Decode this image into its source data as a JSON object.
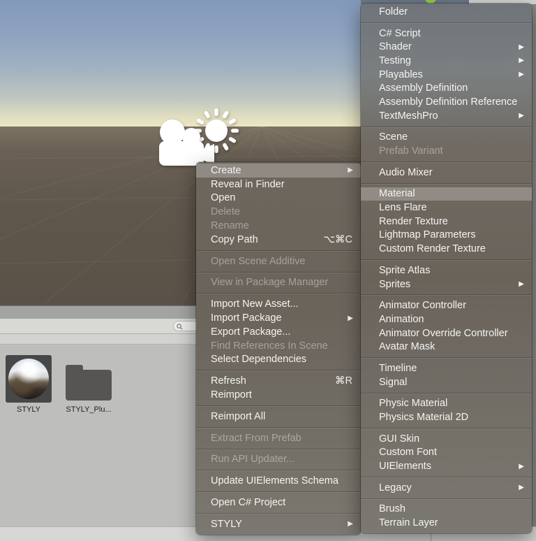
{
  "icons": {
    "submenu_arrow": "▶",
    "search": "magnifier",
    "collab_arrow": "green-down-arrow"
  },
  "colors": {
    "menu_text": "#f5f4f2",
    "menu_highlight": "rgba(255,255,255,0.24)",
    "collab_arrow_green": "#90c94e",
    "project_bg": "#bebebd",
    "selected_tile_bg": "#474747"
  },
  "scene": {
    "gizmos": [
      {
        "name": "camera"
      },
      {
        "name": "directional-light-sun"
      }
    ]
  },
  "project_panel": {
    "search": {
      "value": "",
      "placeholder": ""
    },
    "assets": [
      {
        "label": "STYLY",
        "type": "skybox-thumbnail",
        "selected": true
      },
      {
        "label": "STYLY_Plu...",
        "type": "folder",
        "selected": false
      }
    ]
  },
  "menus": {
    "left": {
      "name": "project-context-menu",
      "groups": [
        {
          "items": [
            {
              "label": "Create",
              "submenu": true,
              "highlighted": true
            },
            {
              "label": "Reveal in Finder"
            },
            {
              "label": "Open"
            },
            {
              "label": "Delete",
              "disabled": true
            },
            {
              "label": "Rename",
              "disabled": true
            },
            {
              "label": "Copy Path",
              "shortcut": "⌥⌘C"
            }
          ]
        },
        {
          "items": [
            {
              "label": "Open Scene Additive",
              "disabled": true
            }
          ]
        },
        {
          "items": [
            {
              "label": "View in Package Manager",
              "disabled": true
            }
          ]
        },
        {
          "items": [
            {
              "label": "Import New Asset..."
            },
            {
              "label": "Import Package",
              "submenu": true
            },
            {
              "label": "Export Package..."
            },
            {
              "label": "Find References In Scene",
              "disabled": true
            },
            {
              "label": "Select Dependencies"
            }
          ]
        },
        {
          "items": [
            {
              "label": "Refresh",
              "shortcut": "⌘R"
            },
            {
              "label": "Reimport"
            }
          ]
        },
        {
          "items": [
            {
              "label": "Reimport All"
            }
          ]
        },
        {
          "items": [
            {
              "label": "Extract From Prefab",
              "disabled": true
            }
          ]
        },
        {
          "items": [
            {
              "label": "Run API Updater...",
              "disabled": true
            }
          ]
        },
        {
          "items": [
            {
              "label": "Update UIElements Schema"
            }
          ]
        },
        {
          "items": [
            {
              "label": "Open C# Project"
            }
          ]
        },
        {
          "items": [
            {
              "label": "STYLY",
              "submenu": true
            }
          ]
        }
      ]
    },
    "create": {
      "name": "create-submenu",
      "groups": [
        {
          "items": [
            {
              "label": "Folder"
            }
          ]
        },
        {
          "items": [
            {
              "label": "C# Script"
            },
            {
              "label": "Shader",
              "submenu": true
            },
            {
              "label": "Testing",
              "submenu": true
            },
            {
              "label": "Playables",
              "submenu": true
            },
            {
              "label": "Assembly Definition"
            },
            {
              "label": "Assembly Definition Reference"
            },
            {
              "label": "TextMeshPro",
              "submenu": true
            }
          ]
        },
        {
          "items": [
            {
              "label": "Scene"
            },
            {
              "label": "Prefab Variant",
              "disabled": true
            }
          ]
        },
        {
          "items": [
            {
              "label": "Audio Mixer"
            }
          ]
        },
        {
          "items": [
            {
              "label": "Material",
              "highlighted": true
            },
            {
              "label": "Lens Flare"
            },
            {
              "label": "Render Texture"
            },
            {
              "label": "Lightmap Parameters"
            },
            {
              "label": "Custom Render Texture"
            }
          ]
        },
        {
          "items": [
            {
              "label": "Sprite Atlas"
            },
            {
              "label": "Sprites",
              "submenu": true
            }
          ]
        },
        {
          "items": [
            {
              "label": "Animator Controller"
            },
            {
              "label": "Animation"
            },
            {
              "label": "Animator Override Controller"
            },
            {
              "label": "Avatar Mask"
            }
          ]
        },
        {
          "items": [
            {
              "label": "Timeline"
            },
            {
              "label": "Signal"
            }
          ]
        },
        {
          "items": [
            {
              "label": "Physic Material"
            },
            {
              "label": "Physics Material 2D"
            }
          ]
        },
        {
          "items": [
            {
              "label": "GUI Skin"
            },
            {
              "label": "Custom Font"
            },
            {
              "label": "UIElements",
              "submenu": true
            }
          ]
        },
        {
          "items": [
            {
              "label": "Legacy",
              "submenu": true
            }
          ]
        },
        {
          "items": [
            {
              "label": "Brush"
            },
            {
              "label": "Terrain Layer"
            }
          ]
        }
      ]
    }
  }
}
